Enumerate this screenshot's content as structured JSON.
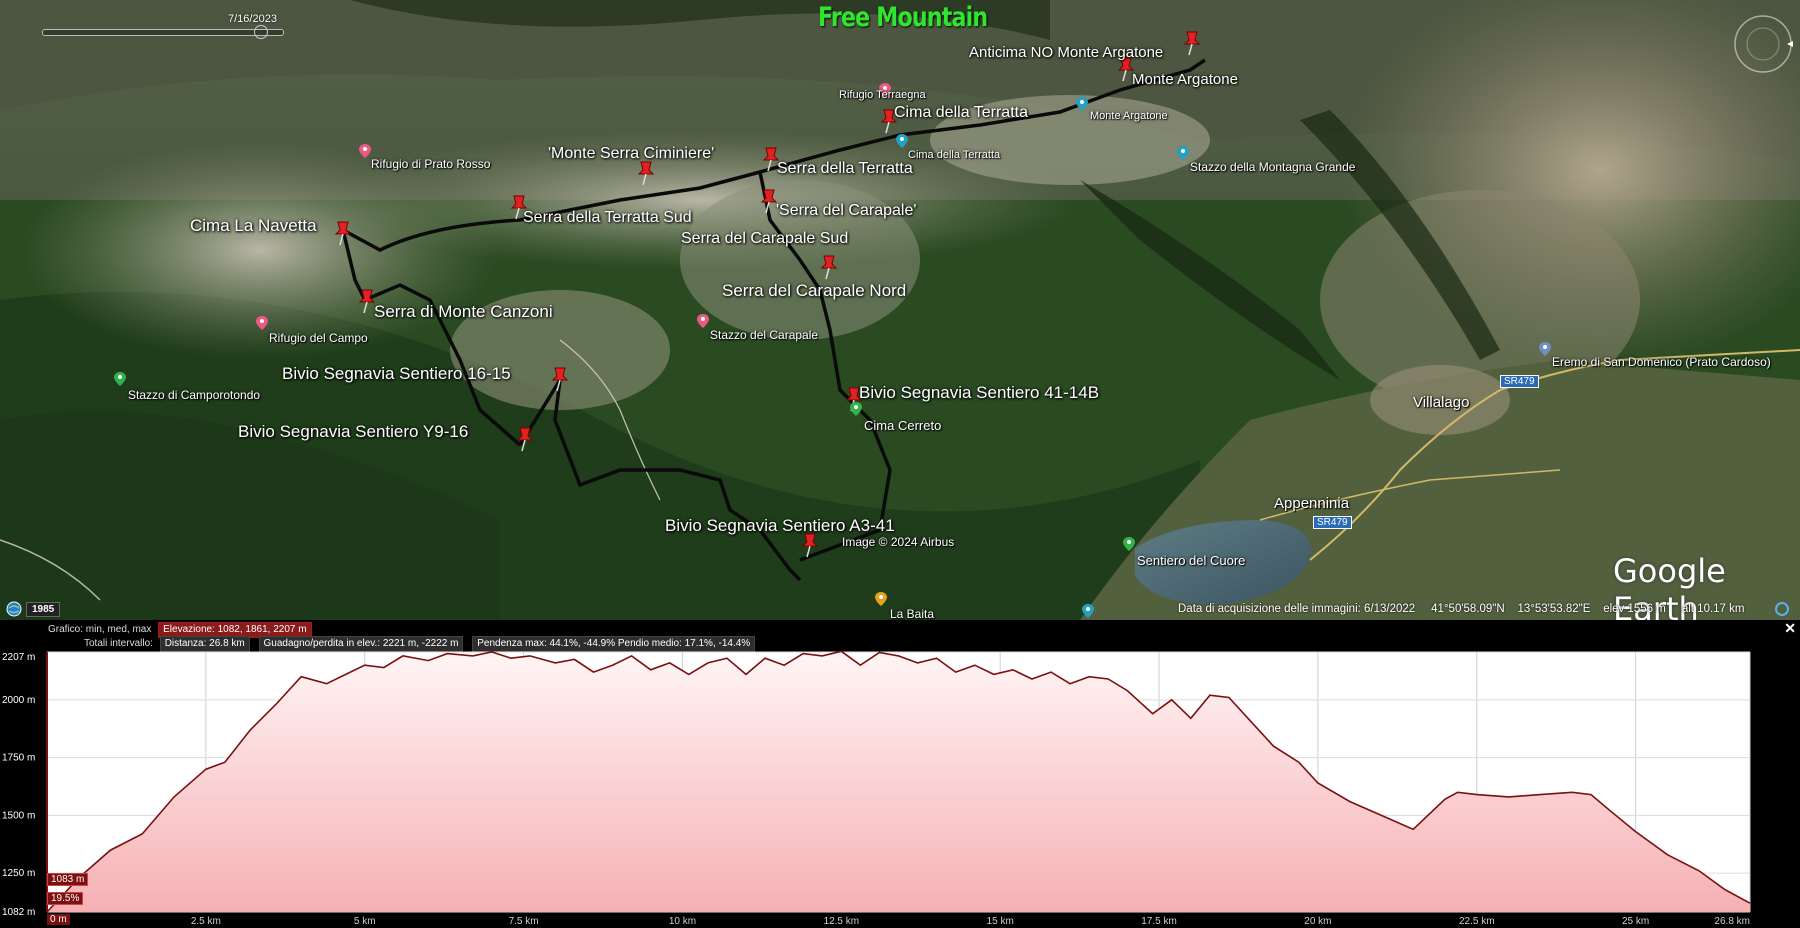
{
  "brand": "Free Mountain",
  "slider_date": "7/16/2023",
  "year": "1985",
  "watermark": "Google Earth",
  "status": {
    "acquisition": "Data di acquisizione delle immagini: 6/13/2022",
    "lat": "41°50'58.09\"N",
    "lon": "13°53'53.82\"E",
    "elev": "elev  1556 m",
    "alt": "alt  10.17 km"
  },
  "credit": "Image © 2024 Airbus",
  "route_labels": [
    {
      "id": "anticima",
      "text": "Anticima NO Monte Argatone"
    },
    {
      "id": "argatone",
      "text": "Monte Argatone"
    },
    {
      "id": "terratta",
      "text": "Cima della Terratta"
    },
    {
      "id": "ciminiere",
      "text": "'Monte Serra Ciminiere'"
    },
    {
      "id": "serraterratta",
      "text": "Serra della Terratta"
    },
    {
      "id": "carapale",
      "text": "'Serra del Carapale'"
    },
    {
      "id": "terrattasud",
      "text": "Serra della Terratta Sud"
    },
    {
      "id": "navetta",
      "text": "Cima La Navetta"
    },
    {
      "id": "carapalesud",
      "text": "Serra del Carapale Sud"
    },
    {
      "id": "carapalenord",
      "text": "Serra del Carapale Nord"
    },
    {
      "id": "canzoni",
      "text": "Serra di Monte Canzoni"
    },
    {
      "id": "b1615",
      "text": "Bivio Segnavia Sentiero 16-15"
    },
    {
      "id": "b41",
      "text": "Bivio Segnavia Sentiero 41-14B"
    },
    {
      "id": "by916",
      "text": "Bivio Segnavia Sentiero Y9-16"
    },
    {
      "id": "ba341",
      "text": "Bivio Segnavia Sentiero A3-41"
    }
  ],
  "poi_labels": [
    {
      "id": "terraegna",
      "text": "Rifugio Terraegna"
    },
    {
      "id": "pratorosso",
      "text": "Rifugio di Prato Rosso"
    },
    {
      "id": "argatone2",
      "text": "Monte Argatone"
    },
    {
      "id": "terratta2",
      "text": "Cima della Terratta"
    },
    {
      "id": "montagnagrande",
      "text": "Stazzo della Montagna Grande"
    },
    {
      "id": "campo",
      "text": "Rifugio del Campo"
    },
    {
      "id": "stazzocarapale",
      "text": "Stazzo del Carapale"
    },
    {
      "id": "camporotondo",
      "text": "Stazzo di Camporotondo"
    },
    {
      "id": "cerreto",
      "text": "Cima Cerreto"
    },
    {
      "id": "eremo",
      "text": "Eremo di San Domenico (Prato Cardoso)"
    },
    {
      "id": "villalago",
      "text": "Villalago"
    },
    {
      "id": "appennina",
      "text": "Appenninia"
    },
    {
      "id": "cuore",
      "text": "Sentiero del Cuore"
    },
    {
      "id": "baita",
      "text": "La Baita"
    }
  ],
  "roads": [
    "SR479",
    "SR479"
  ],
  "profile": {
    "row1_label": "Grafico: min, med, max",
    "row1_value": "Elevazione: 1082, 1861, 2207 m",
    "row2_label": "Totali intervallo:",
    "distance": "Distanza: 26.8 km",
    "gain": "Guadagno/perdita in elev.: 2221 m, -2222 m",
    "slope": "Pendenza max: 44.1%, -44.9%  Pendio medio: 17.1%, -14.4%",
    "cursor_elev": "1083 m",
    "cursor_slope": "19.5%",
    "cursor_dist": "0 m"
  },
  "chart_data": {
    "type": "area",
    "x_unit": "km",
    "y_unit": "m",
    "xlim": [
      0,
      26.8
    ],
    "ylim": [
      1082,
      2207
    ],
    "x_ticks": [
      {
        "v": 2.5,
        "label": "2.5 km"
      },
      {
        "v": 5,
        "label": "5 km"
      },
      {
        "v": 7.5,
        "label": "7.5 km"
      },
      {
        "v": 10,
        "label": "10 km"
      },
      {
        "v": 12.5,
        "label": "12.5 km"
      },
      {
        "v": 15,
        "label": "15 km"
      },
      {
        "v": 17.5,
        "label": "17.5 km"
      },
      {
        "v": 20,
        "label": "20 km"
      },
      {
        "v": 22.5,
        "label": "22.5 km"
      },
      {
        "v": 25,
        "label": "25 km"
      },
      {
        "v": 26.8,
        "label": "26.8 km"
      }
    ],
    "y_ticks": [
      {
        "v": 1082,
        "label": "1082 m"
      },
      {
        "v": 1250,
        "label": "1250 m"
      },
      {
        "v": 1500,
        "label": "1500 m"
      },
      {
        "v": 1750,
        "label": "1750 m"
      },
      {
        "v": 2000,
        "label": "2000 m"
      },
      {
        "v": 2207,
        "label": "2207 m"
      }
    ],
    "grid": true,
    "color": "#7a1010",
    "x": [
      0,
      0.5,
      1,
      1.5,
      2,
      2.5,
      2.8,
      3.2,
      3.6,
      4,
      4.4,
      4.7,
      5,
      5.3,
      5.6,
      6,
      6.3,
      6.7,
      7,
      7.3,
      7.6,
      8,
      8.3,
      8.6,
      8.9,
      9.2,
      9.5,
      9.8,
      10.1,
      10.4,
      10.7,
      11,
      11.3,
      11.6,
      11.9,
      12.2,
      12.5,
      12.8,
      13.1,
      13.4,
      13.7,
      14,
      14.3,
      14.6,
      14.9,
      15.2,
      15.5,
      15.8,
      16.1,
      16.4,
      16.7,
      17,
      17.4,
      17.7,
      18,
      18.3,
      18.6,
      19,
      19.3,
      19.7,
      20,
      20.5,
      21,
      21.5,
      22,
      22.2,
      22.5,
      23,
      23.5,
      24,
      24.3,
      24.6,
      25,
      25.5,
      26,
      26.4,
      26.8
    ],
    "y": [
      1082,
      1230,
      1350,
      1420,
      1580,
      1700,
      1730,
      1870,
      1980,
      2100,
      2070,
      2110,
      2150,
      2140,
      2190,
      2170,
      2200,
      2190,
      2207,
      2180,
      2190,
      2160,
      2175,
      2120,
      2150,
      2190,
      2130,
      2160,
      2110,
      2160,
      2180,
      2110,
      2180,
      2150,
      2200,
      2190,
      2210,
      2150,
      2205,
      2190,
      2160,
      2180,
      2120,
      2150,
      2110,
      2130,
      2090,
      2120,
      2070,
      2100,
      2090,
      2040,
      1940,
      2000,
      1920,
      2020,
      2010,
      1890,
      1800,
      1730,
      1640,
      1560,
      1500,
      1440,
      1570,
      1600,
      1590,
      1580,
      1590,
      1600,
      1590,
      1520,
      1430,
      1330,
      1260,
      1180,
      1120
    ]
  }
}
